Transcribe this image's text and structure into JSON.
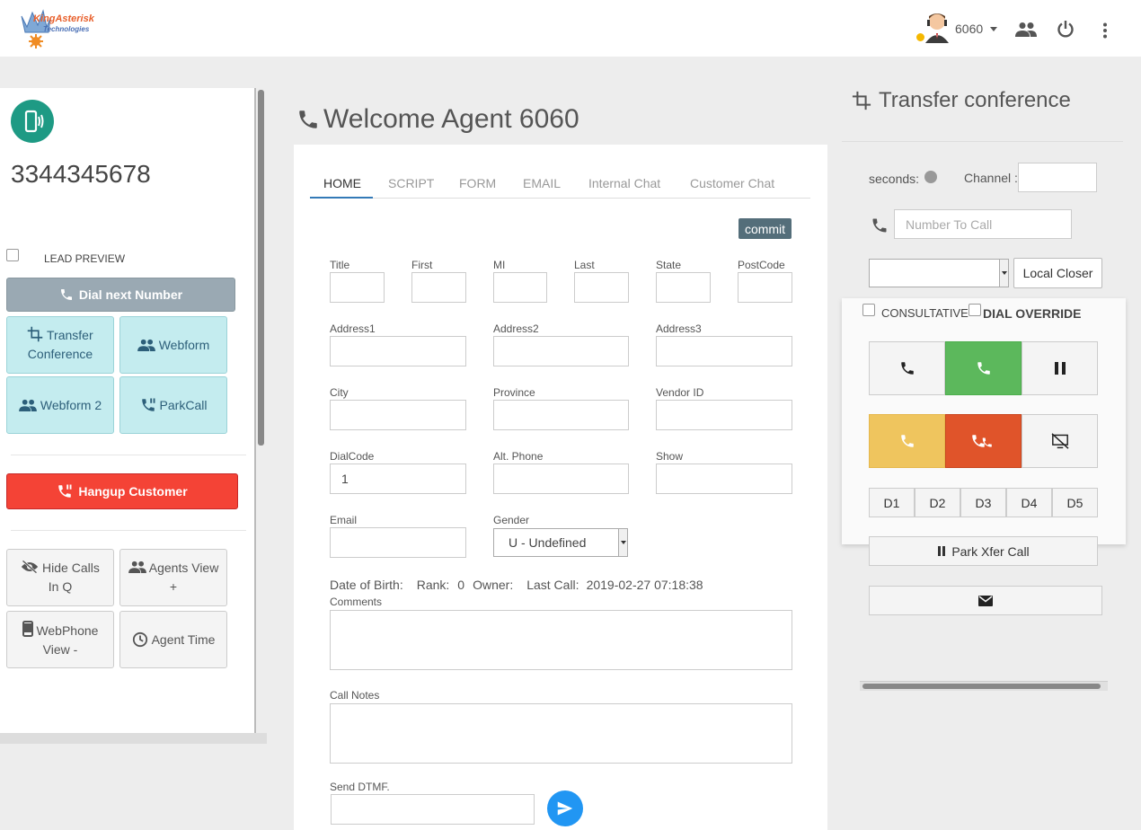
{
  "header": {
    "logo_line1": "KingAsterisk",
    "logo_line2": "Technologies",
    "user_ext": "6060"
  },
  "left": {
    "phone_number": "3344345678",
    "lead_preview": "LEAD PREVIEW",
    "dial_next": "Dial next Number",
    "transfer_line1": "Transfer",
    "transfer_line2": "Conference",
    "webform": "Webform",
    "webform2": "Webform 2",
    "parkcall": "ParkCall",
    "hangup": "Hangup Customer",
    "hide_calls_line1": "Hide Calls",
    "hide_calls_line2": "In Q",
    "agents_view_line1": "Agents View",
    "agents_view_line2": "+",
    "webphone_line1": "WebPhone",
    "webphone_line2": "View -",
    "agent_time": "Agent Time"
  },
  "main": {
    "welcome": "Welcome Agent 6060",
    "tabs": [
      "HOME",
      "SCRIPT",
      "FORM",
      "EMAIL",
      "Internal Chat",
      "Customer Chat"
    ],
    "commit": "commit",
    "fields": {
      "title": "Title",
      "first": "First",
      "mi": "MI",
      "last": "Last",
      "state": "State",
      "postcode": "PostCode",
      "address1": "Address1",
      "address2": "Address2",
      "address3": "Address3",
      "city": "City",
      "province": "Province",
      "vendor_id": "Vendor ID",
      "dialcode": "DialCode",
      "alt_phone": "Alt. Phone",
      "show": "Show",
      "email": "Email",
      "gender": "Gender",
      "comments": "Comments",
      "call_notes": "Call Notes",
      "send_dtmf": "Send DTMF."
    },
    "dialcode_value": "1",
    "gender_value": "U - Undefined",
    "info": {
      "dob_label": "Date of Birth:",
      "rank_label": "Rank:",
      "rank_value": "0",
      "owner_label": "Owner:",
      "last_call_label": "Last Call:",
      "last_call_value": "2019-02-27 07:18:38"
    }
  },
  "right": {
    "title": "Transfer conference",
    "seconds": "seconds:",
    "channel": "Channel :",
    "number_placeholder": "Number To Call",
    "local_closer": "Local Closer",
    "consultative": "CONSULTATIVE",
    "dial_override": "DIAL OVERRIDE",
    "dtmf_buttons": [
      "D1",
      "D2",
      "D3",
      "D4",
      "D5"
    ],
    "park_xfer": "Park Xfer Call"
  }
}
